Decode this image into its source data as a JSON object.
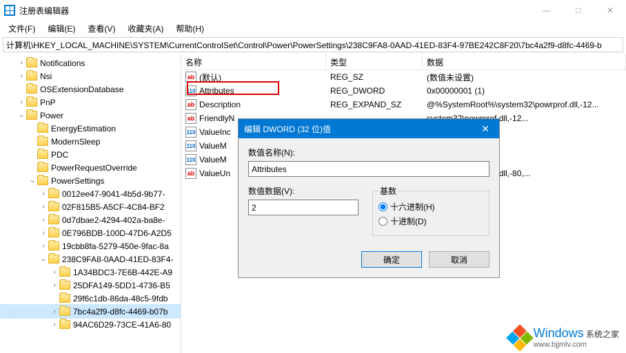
{
  "window": {
    "title": "注册表编辑器"
  },
  "menu": {
    "file": "文件(F)",
    "edit": "编辑(E)",
    "view": "查看(V)",
    "favorites": "收藏夹(A)",
    "help": "帮助(H)"
  },
  "address": "计算机\\HKEY_LOCAL_MACHINE\\SYSTEM\\CurrentControlSet\\Control\\Power\\PowerSettings\\238C9FA8-0AAD-41ED-83F4-97BE242C8F20\\7bc4a2f9-d8fc-4469-b",
  "tree": [
    {
      "indent": 1,
      "chev": "closed",
      "label": "Notifications"
    },
    {
      "indent": 1,
      "chev": "closed",
      "label": "Nsi"
    },
    {
      "indent": 1,
      "chev": "none",
      "label": "OSExtensionDatabase"
    },
    {
      "indent": 1,
      "chev": "closed",
      "label": "PnP"
    },
    {
      "indent": 1,
      "chev": "open",
      "label": "Power"
    },
    {
      "indent": 2,
      "chev": "none",
      "label": "EnergyEstimation"
    },
    {
      "indent": 2,
      "chev": "none",
      "label": "ModernSleep"
    },
    {
      "indent": 2,
      "chev": "none",
      "label": "PDC"
    },
    {
      "indent": 2,
      "chev": "none",
      "label": "PowerRequestOverride"
    },
    {
      "indent": 2,
      "chev": "open",
      "label": "PowerSettings"
    },
    {
      "indent": 3,
      "chev": "closed",
      "label": "0012ee47-9041-4b5d-9b77-"
    },
    {
      "indent": 3,
      "chev": "closed",
      "label": "02F815B5-A5CF-4C84-BF2"
    },
    {
      "indent": 3,
      "chev": "closed",
      "label": "0d7dbae2-4294-402a-ba8e-"
    },
    {
      "indent": 3,
      "chev": "closed",
      "label": "0E796BDB-100D-47D6-A2D5"
    },
    {
      "indent": 3,
      "chev": "closed",
      "label": "19cbb8fa-5279-450e-9fac-8a"
    },
    {
      "indent": 3,
      "chev": "open",
      "label": "238C9FA8-0AAD-41ED-83F4-"
    },
    {
      "indent": 4,
      "chev": "closed",
      "label": "1A34BDC3-7E6B-442E-A9"
    },
    {
      "indent": 4,
      "chev": "closed",
      "label": "25DFA149-5DD1-4736-B5"
    },
    {
      "indent": 4,
      "chev": "none",
      "label": "29f6c1db-86da-48c5-9fdb"
    },
    {
      "indent": 4,
      "chev": "closed",
      "label": "7bc4a2f9-d8fc-4469-b07b",
      "selected": true
    },
    {
      "indent": 4,
      "chev": "closed",
      "label": "94AC6D29-73CE-41A6-80"
    }
  ],
  "list": {
    "headers": {
      "name": "名称",
      "type": "类型",
      "data": "数据"
    },
    "rows": [
      {
        "icon": "ab",
        "name": "(默认)",
        "type": "REG_SZ",
        "data": "(数值未设置)"
      },
      {
        "icon": "bin",
        "name": "Attributes",
        "type": "REG_DWORD",
        "data": "0x00000001 (1)"
      },
      {
        "icon": "ab",
        "name": "Description",
        "type": "REG_EXPAND_SZ",
        "data": "@%SystemRoot%\\system32\\powrprof.dll,-12..."
      },
      {
        "icon": "ab",
        "name": "FriendlyN",
        "type": "",
        "data": "                                                        system32\\powrprof.dll,-12..."
      },
      {
        "icon": "bin",
        "name": "ValueInc",
        "type": "",
        "data": ""
      },
      {
        "icon": "bin",
        "name": "ValueM",
        "type": "",
        "data": ""
      },
      {
        "icon": "bin",
        "name": "ValueM",
        "type": "",
        "data": ""
      },
      {
        "icon": "ab",
        "name": "ValueUn",
        "type": "",
        "data": "                                                        system32\\powrprof.dll,-80,..."
      }
    ]
  },
  "dialog": {
    "title": "编辑 DWORD (32 位)值",
    "name_label": "数值名称(N):",
    "name_value": "Attributes",
    "data_label": "数值数据(V):",
    "data_value": "2",
    "base_label": "基数",
    "hex_label": "十六进制(H)",
    "dec_label": "十进制(D)",
    "ok": "确定",
    "cancel": "取消"
  },
  "watermark": {
    "brand": "Windows",
    "suffix": "系统之家",
    "url": "www.bjjmlv.com"
  }
}
